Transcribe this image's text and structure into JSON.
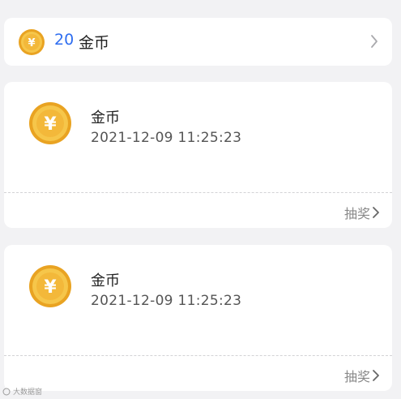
{
  "summary": {
    "amount": "20",
    "unit": "金币",
    "coin_icon": "coin-icon",
    "chevron_icon": "chevron-right-icon"
  },
  "records": [
    {
      "title": "金币",
      "time": "2021-12-09 11:25:23",
      "action": "抽奖"
    },
    {
      "title": "金币",
      "time": "2021-12-09 11:25:23",
      "action": "抽奖"
    }
  ],
  "watermark": {
    "text": "大数据窗"
  },
  "colors": {
    "accent": "#2f6ef0",
    "coin_gold": "#f2b632",
    "background": "#f2f2f4"
  }
}
